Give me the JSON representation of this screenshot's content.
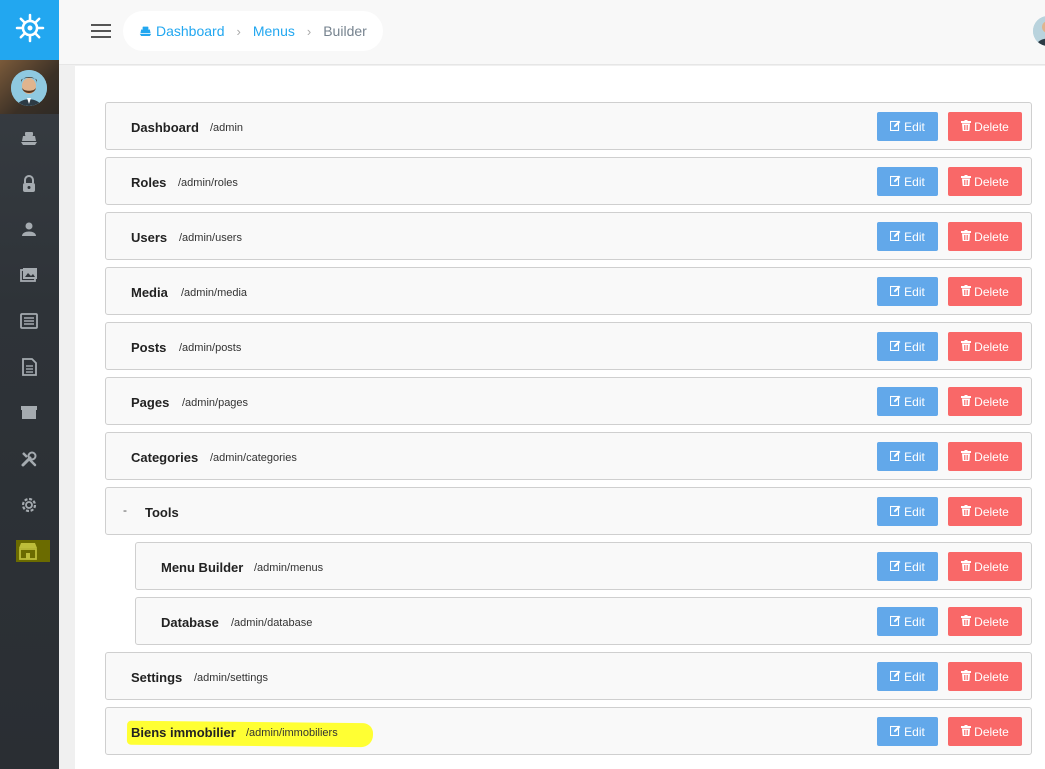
{
  "breadcrumb": {
    "dashboard": "Dashboard",
    "menus": "Menus",
    "builder": "Builder"
  },
  "colors": {
    "accent": "#22a7f0",
    "edit": "#62a8ea",
    "delete": "#f96868",
    "highlight": "#ffff33"
  },
  "sidebar": {
    "icons": [
      "helm-logo-icon",
      "avatar",
      "dashboard-icon",
      "lock-icon",
      "user-icon",
      "media-icon",
      "posts-icon",
      "pages-icon",
      "categories-icon",
      "tools-icon",
      "settings-icon",
      "store-icon"
    ]
  },
  "buttons": {
    "edit": "Edit",
    "delete": "Delete"
  },
  "tools_toggle": "-",
  "menu_items": [
    {
      "title": "Dashboard",
      "url": "/admin"
    },
    {
      "title": "Roles",
      "url": "/admin/roles"
    },
    {
      "title": "Users",
      "url": "/admin/users"
    },
    {
      "title": "Media",
      "url": "/admin/media"
    },
    {
      "title": "Posts",
      "url": "/admin/posts"
    },
    {
      "title": "Pages",
      "url": "/admin/pages"
    },
    {
      "title": "Categories",
      "url": "/admin/categories"
    },
    {
      "title": "Tools",
      "url": ""
    },
    {
      "title": "Menu Builder",
      "url": "/admin/menus"
    },
    {
      "title": "Database",
      "url": "/admin/database"
    },
    {
      "title": "Settings",
      "url": "/admin/settings"
    },
    {
      "title": "Biens immobilier",
      "url": "/admin/immobiliers"
    }
  ]
}
